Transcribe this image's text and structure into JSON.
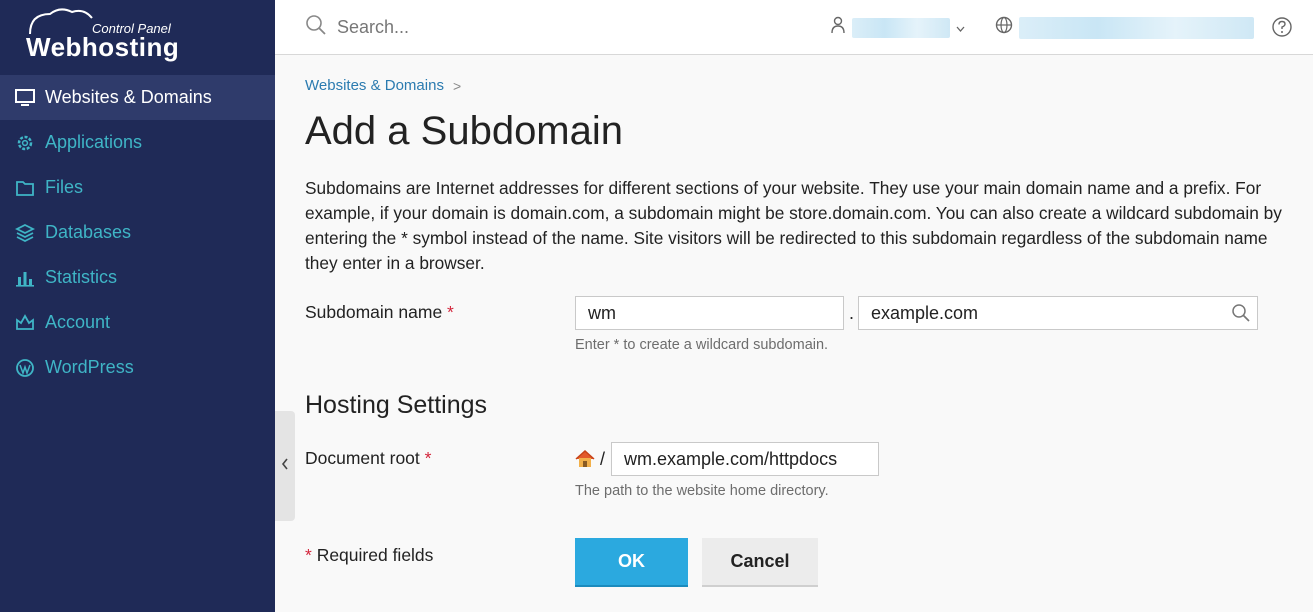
{
  "brand": {
    "logo_small": "Control Panel",
    "logo_big": "Webhosting"
  },
  "sidebar": {
    "items": [
      {
        "label": "Websites & Domains",
        "icon": "monitor-icon",
        "active": true
      },
      {
        "label": "Applications",
        "icon": "gear-icon"
      },
      {
        "label": "Files",
        "icon": "folder-icon"
      },
      {
        "label": "Databases",
        "icon": "layers-icon"
      },
      {
        "label": "Statistics",
        "icon": "bar-chart-icon"
      },
      {
        "label": "Account",
        "icon": "crown-icon"
      },
      {
        "label": "WordPress",
        "icon": "wordpress-icon"
      }
    ]
  },
  "topbar": {
    "search_placeholder": "Search..."
  },
  "breadcrumb": {
    "item": "Websites & Domains",
    "separator": ">"
  },
  "page": {
    "title": "Add a Subdomain",
    "description": "Subdomains are Internet addresses for different sections of your website. They use your main domain name and a prefix. For example, if your domain is domain.com, a subdomain might be store.domain.com. You can also create a wildcard subdomain by entering the * symbol instead of the name. Site visitors will be redirected to this subdomain regardless of the subdomain name they enter in a browser."
  },
  "form": {
    "subdomain_label": "Subdomain name",
    "required_mark": "*",
    "subdomain_value": "wm",
    "dot": ".",
    "domain_value": "example.com",
    "subdomain_hint": "Enter * to create a wildcard subdomain.",
    "hosting_heading": "Hosting Settings",
    "docroot_label": "Document root",
    "docroot_slash": "/",
    "docroot_value": "wm.example.com/httpdocs",
    "docroot_hint": "The path to the website home directory.",
    "required_fields": "Required fields",
    "ok_label": "OK",
    "cancel_label": "Cancel"
  },
  "colors": {
    "sidebar_bg": "#1f2a57",
    "accent": "#3fb5c6",
    "primary_button": "#2ba9df",
    "link": "#2b7bb0",
    "required": "#d3263c"
  }
}
